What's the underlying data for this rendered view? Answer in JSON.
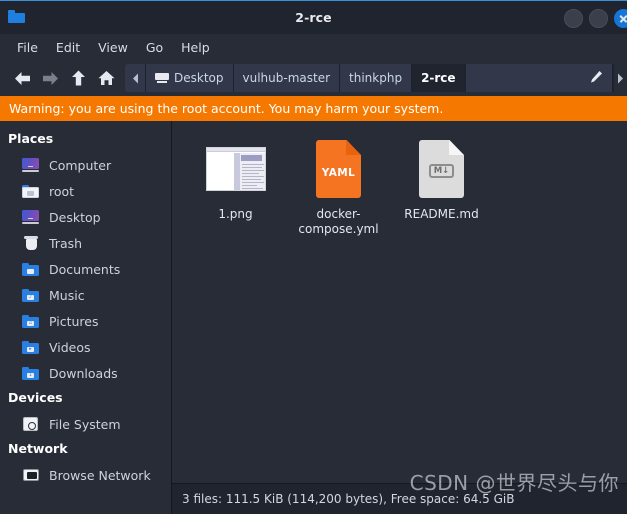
{
  "window": {
    "title": "2-rce",
    "app_icon": "folder-icon",
    "controls": [
      {
        "name": "minimize-button",
        "label": ""
      },
      {
        "name": "maximize-button",
        "label": ""
      },
      {
        "name": "close-button",
        "label": ""
      }
    ]
  },
  "menubar": {
    "items": [
      {
        "label": "File"
      },
      {
        "label": "Edit"
      },
      {
        "label": "View"
      },
      {
        "label": "Go"
      },
      {
        "label": "Help"
      }
    ]
  },
  "toolbar": {
    "back": "back-arrow-icon",
    "forward": "forward-arrow-icon",
    "up": "up-arrow-icon",
    "home": "home-icon",
    "scroll_left": "chevron-left-icon",
    "scroll_right": "chevron-right-icon",
    "edit_path": "pencil-icon",
    "breadcrumbs": [
      {
        "label": "Desktop",
        "icon": "monitor-icon",
        "active": false
      },
      {
        "label": "vulhub-master",
        "icon": "",
        "active": false
      },
      {
        "label": "thinkphp",
        "icon": "",
        "active": false
      },
      {
        "label": "2-rce",
        "icon": "",
        "active": true
      }
    ]
  },
  "warning": {
    "text": "Warning: you are using the root account. You may harm your system.",
    "color": "#f57900"
  },
  "sidebar": {
    "sections": [
      {
        "heading": "Places",
        "items": [
          {
            "label": "Computer",
            "icon": "computer-icon"
          },
          {
            "label": "root",
            "icon": "home-folder-icon"
          },
          {
            "label": "Desktop",
            "icon": "desktop-icon"
          },
          {
            "label": "Trash",
            "icon": "trash-icon"
          },
          {
            "label": "Documents",
            "icon": "documents-folder-icon"
          },
          {
            "label": "Music",
            "icon": "music-folder-icon"
          },
          {
            "label": "Pictures",
            "icon": "pictures-folder-icon"
          },
          {
            "label": "Videos",
            "icon": "videos-folder-icon"
          },
          {
            "label": "Downloads",
            "icon": "downloads-folder-icon"
          }
        ]
      },
      {
        "heading": "Devices",
        "items": [
          {
            "label": "File System",
            "icon": "harddisk-icon"
          }
        ]
      },
      {
        "heading": "Network",
        "items": [
          {
            "label": "Browse Network",
            "icon": "network-icon"
          }
        ]
      }
    ]
  },
  "files": [
    {
      "name": "1.png",
      "type": "image-thumbnail"
    },
    {
      "name": "docker-compose.yml",
      "type": "yaml-file-icon",
      "badge": "YAML"
    },
    {
      "name": "README.md",
      "type": "markdown-file-icon",
      "badge": "M↓"
    }
  ],
  "statusbar": {
    "text": "3 files: 111.5 KiB (114,200 bytes), Free space: 64.5 GiB"
  },
  "watermark": {
    "text": "CSDN @世界尽头与你"
  }
}
